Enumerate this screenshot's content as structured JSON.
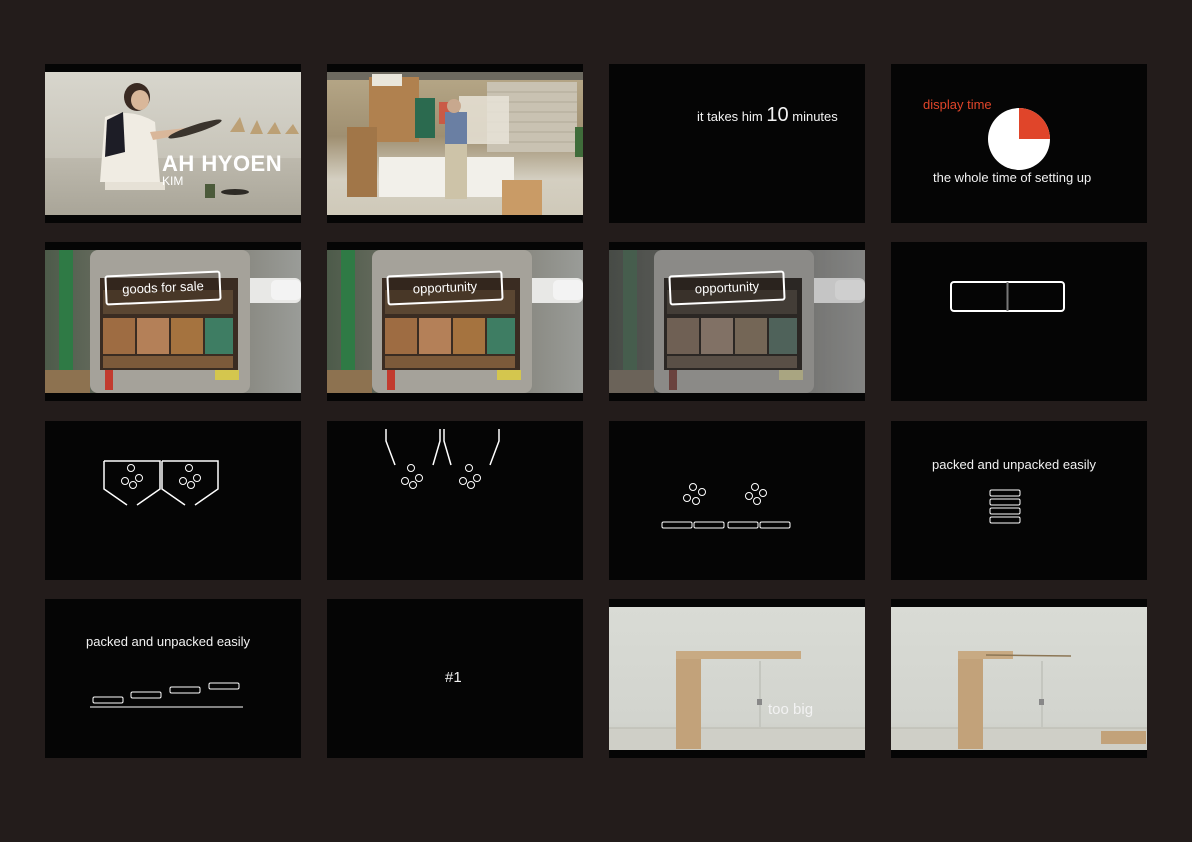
{
  "storyboard": {
    "frame_1": {
      "name": "AH HYOEN",
      "surname": "KIM"
    },
    "frame_3": {
      "prefix": "it takes him",
      "number": "10",
      "suffix": "minutes"
    },
    "frame_4": {
      "label": "display time",
      "caption": "the whole time of setting up",
      "display_fraction": 0.25,
      "accent_color": "#e0452a"
    },
    "frame_5": {
      "label": "goods for sale"
    },
    "frame_6": {
      "label": "opportunity"
    },
    "frame_7": {
      "label": "opportunity"
    },
    "frame_12": {
      "caption": "packed and unpacked easily"
    },
    "frame_13": {
      "caption": "packed and unpacked easily"
    },
    "frame_14": {
      "label": "#1"
    },
    "frame_15": {
      "caption": "too big"
    }
  }
}
